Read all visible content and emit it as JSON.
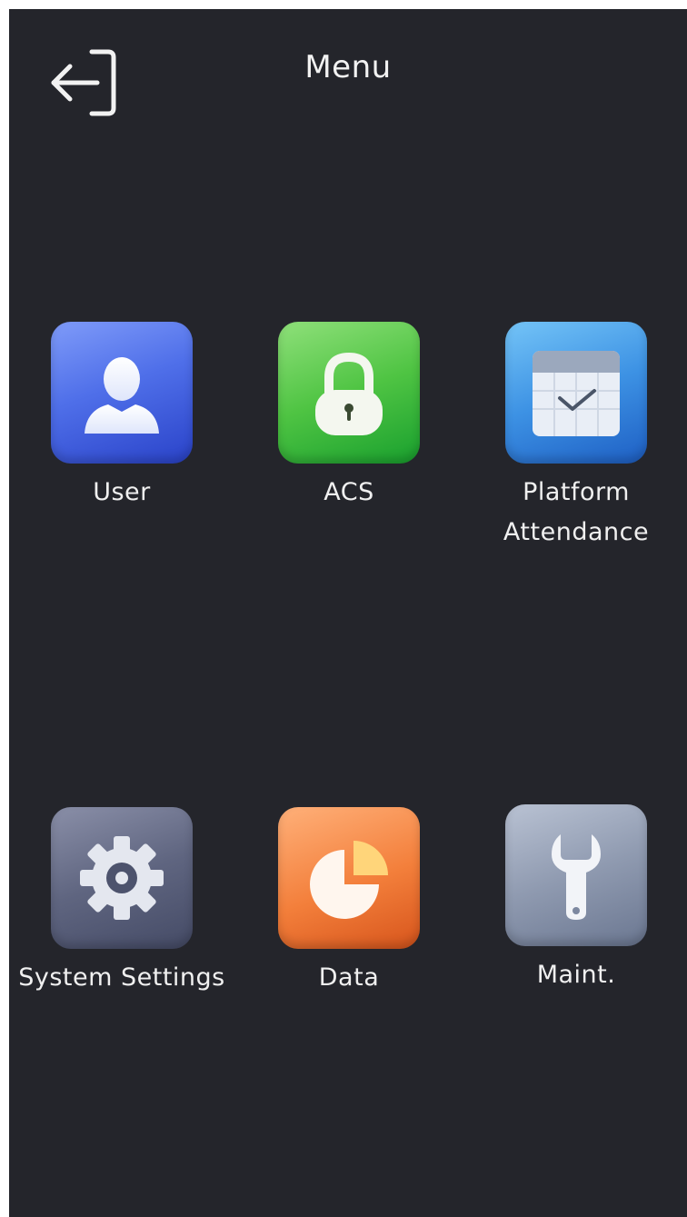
{
  "header": {
    "title": "Menu",
    "back_icon": "exit-icon"
  },
  "menu": {
    "items": [
      {
        "label_lines": [
          "User"
        ],
        "icon": "user-icon",
        "color": "#4f6fe9"
      },
      {
        "label_lines": [
          "ACS"
        ],
        "icon": "lock-icon",
        "color": "#4fc443"
      },
      {
        "label_lines": [
          "Platform",
          "Attendance"
        ],
        "icon": "calendar-check-icon",
        "color": "#3d92e4"
      },
      {
        "label_lines": [
          "System Settings"
        ],
        "icon": "gear-icon",
        "color": "#5f6580"
      },
      {
        "label_lines": [
          "Data"
        ],
        "icon": "pie-chart-icon",
        "color": "#f37f3b"
      },
      {
        "label_lines": [
          "Maint."
        ],
        "icon": "wrench-icon",
        "color": "#8f9ab0"
      }
    ]
  },
  "colors": {
    "background": "#24252b",
    "text": "#f0f0f0"
  }
}
